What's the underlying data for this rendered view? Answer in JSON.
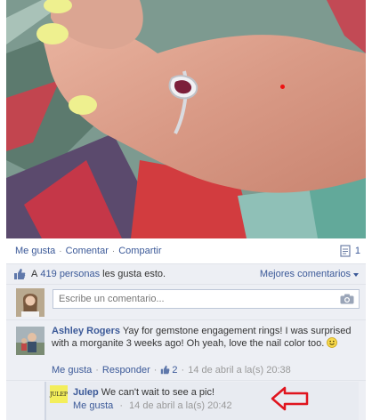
{
  "actions": {
    "like": "Me gusta",
    "comment": "Comentar",
    "share": "Compartir",
    "share_count": "1"
  },
  "likes": {
    "prefix": "A",
    "count_link": "419 personas",
    "suffix": "les gusta esto.",
    "sort_label": "Mejores comentarios"
  },
  "write_comment": {
    "placeholder": "Escribe un comentario..."
  },
  "comments": [
    {
      "author": "Ashley Rogers",
      "text": "Yay for gemstone engagement rings! I was surprised with a morganite 3 weeks ago! Oh yeah, love the nail color too.",
      "like_label": "Me gusta",
      "reply_label": "Responder",
      "like_count": "2",
      "timestamp": "14 de abril a la(s) 20:38"
    }
  ],
  "reply": {
    "author": "Julep",
    "avatar_text": "JULEP",
    "text": "We can't wait to see a pic!",
    "like_label": "Me gusta",
    "timestamp": "14 de abril a la(s) 20:42"
  },
  "colors": {
    "link": "#3b5998",
    "arrow": "#e0141e",
    "feedback_bg": "#edeff4"
  }
}
